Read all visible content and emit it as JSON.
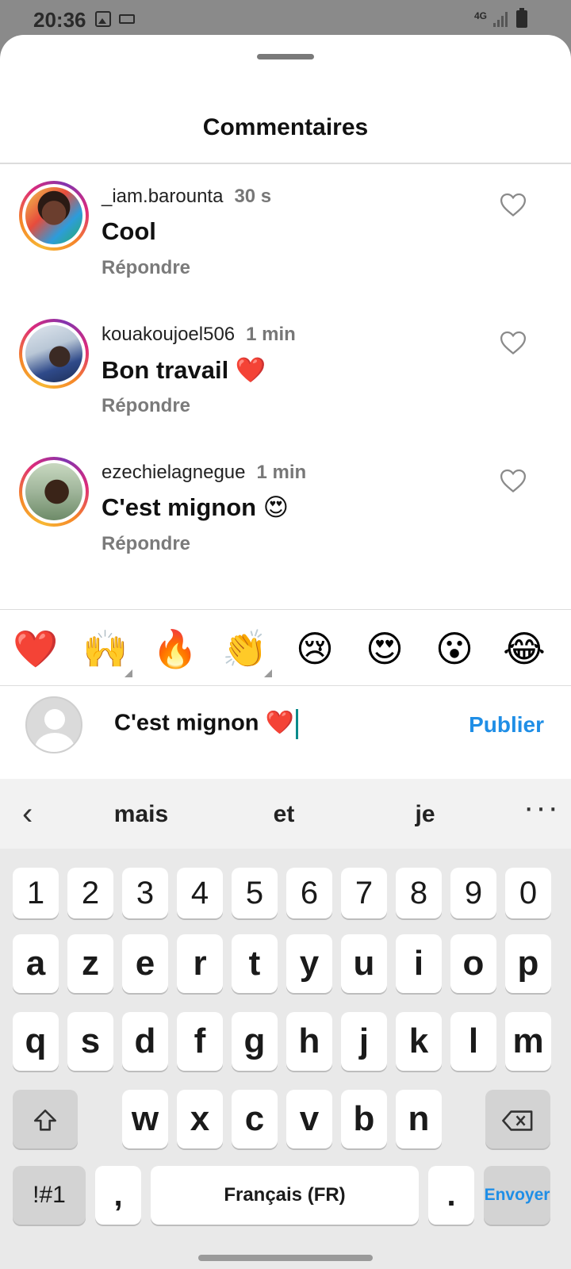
{
  "status_bar": {
    "time": "20:36",
    "network": "4G"
  },
  "sheet": {
    "title": "Commentaires"
  },
  "comments": [
    {
      "username": "_iam.barounta",
      "time": "30 s",
      "text": "Cool",
      "reply": "Répondre"
    },
    {
      "username": "kouakoujoel506",
      "time": "1 min",
      "text": "Bon travail ❤️",
      "reply": "Répondre"
    },
    {
      "username": "ezechielagnegue",
      "time": "1 min",
      "text": "C'est mignon 😍",
      "reply": "Répondre"
    }
  ],
  "emoji_bar": [
    "❤️",
    "🙌",
    "🔥",
    "👏",
    "😢",
    "😍",
    "😮",
    "😂"
  ],
  "composer": {
    "input_value": "C'est mignon ❤️",
    "publish_label": "Publier"
  },
  "keyboard": {
    "suggestions": [
      "mais",
      "et",
      "je"
    ],
    "row_numbers": [
      "1",
      "2",
      "3",
      "4",
      "5",
      "6",
      "7",
      "8",
      "9",
      "0"
    ],
    "row1": [
      "a",
      "z",
      "e",
      "r",
      "t",
      "y",
      "u",
      "i",
      "o",
      "p"
    ],
    "row2": [
      "q",
      "s",
      "d",
      "f",
      "g",
      "h",
      "j",
      "k",
      "l",
      "m"
    ],
    "row3": [
      "w",
      "x",
      "c",
      "v",
      "b",
      "n"
    ],
    "symbols_label": "!#1",
    "comma_label": ",",
    "space_label": "Français (FR)",
    "period_label": ".",
    "send_label": "Envoyer"
  }
}
